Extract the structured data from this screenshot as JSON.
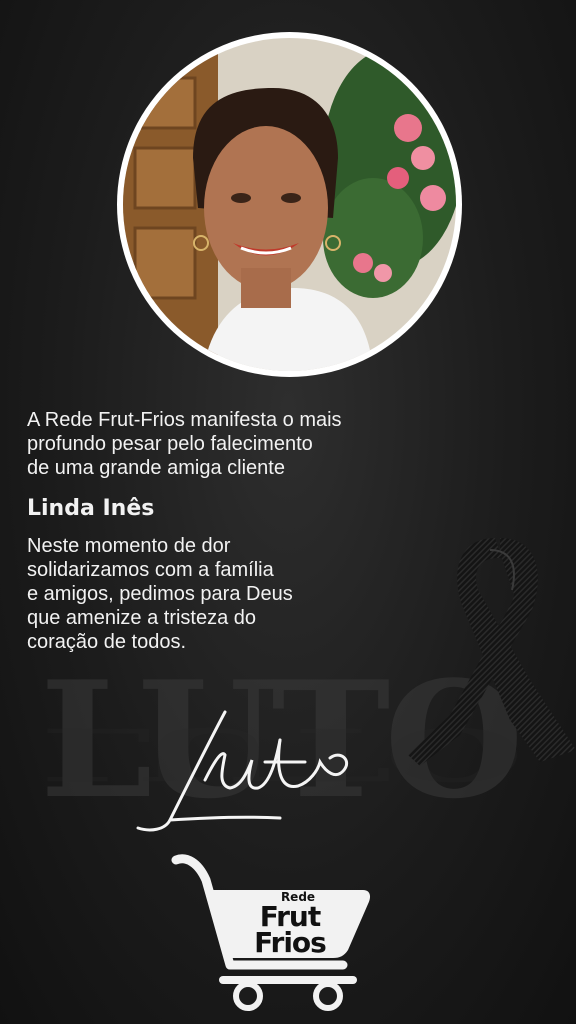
{
  "tribute": {
    "intro_lines": [
      "A Rede Frut-Frios manifesta o mais",
      "profundo pesar pelo falecimento",
      "de uma grande amiga cliente"
    ],
    "name": "Linda Inês",
    "message_lines": [
      "Neste momento de dor",
      "solidarizamos com a família",
      "e amigos, pedimos para Deus",
      "que amenize a tristeza do",
      "coração de todos."
    ]
  },
  "decor": {
    "background_word": "LUTO",
    "script_word": "Luto"
  },
  "logo": {
    "line1": "Rede",
    "line2": "Frut",
    "line3": "Frios"
  },
  "colors": {
    "background": "#1c1c1c",
    "text": "#f2f2f2",
    "ribbon": "#0e0e0e"
  }
}
